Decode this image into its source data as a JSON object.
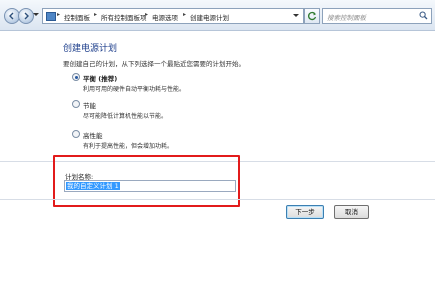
{
  "address": {
    "crumbs": [
      "控制面板",
      "所有控制面板项",
      "电源选项",
      "创建电源计划"
    ],
    "search_placeholder": "搜索控制面板"
  },
  "main": {
    "title": "创建电源计划",
    "subtitle": "要创建自己的计划，从下列选择一个最贴近您需要的计划开始。",
    "options": [
      {
        "label": "平衡 (推荐)",
        "desc": "利用可用的硬件自动平衡功耗与性能。",
        "selected": true
      },
      {
        "label": "节能",
        "desc": "尽可能降低计算机性能以节能。",
        "selected": false
      },
      {
        "label": "高性能",
        "desc": "有利于提高性能，但会增加功耗。",
        "selected": false
      }
    ]
  },
  "plan_name": {
    "label": "计划名称:",
    "value": "我的自定义计划 1"
  },
  "buttons": {
    "next": "下一步",
    "cancel": "取消"
  },
  "colors": {
    "highlight_box": "#e21b1b",
    "title": "#1e3f8c",
    "selection": "#3399ff"
  }
}
